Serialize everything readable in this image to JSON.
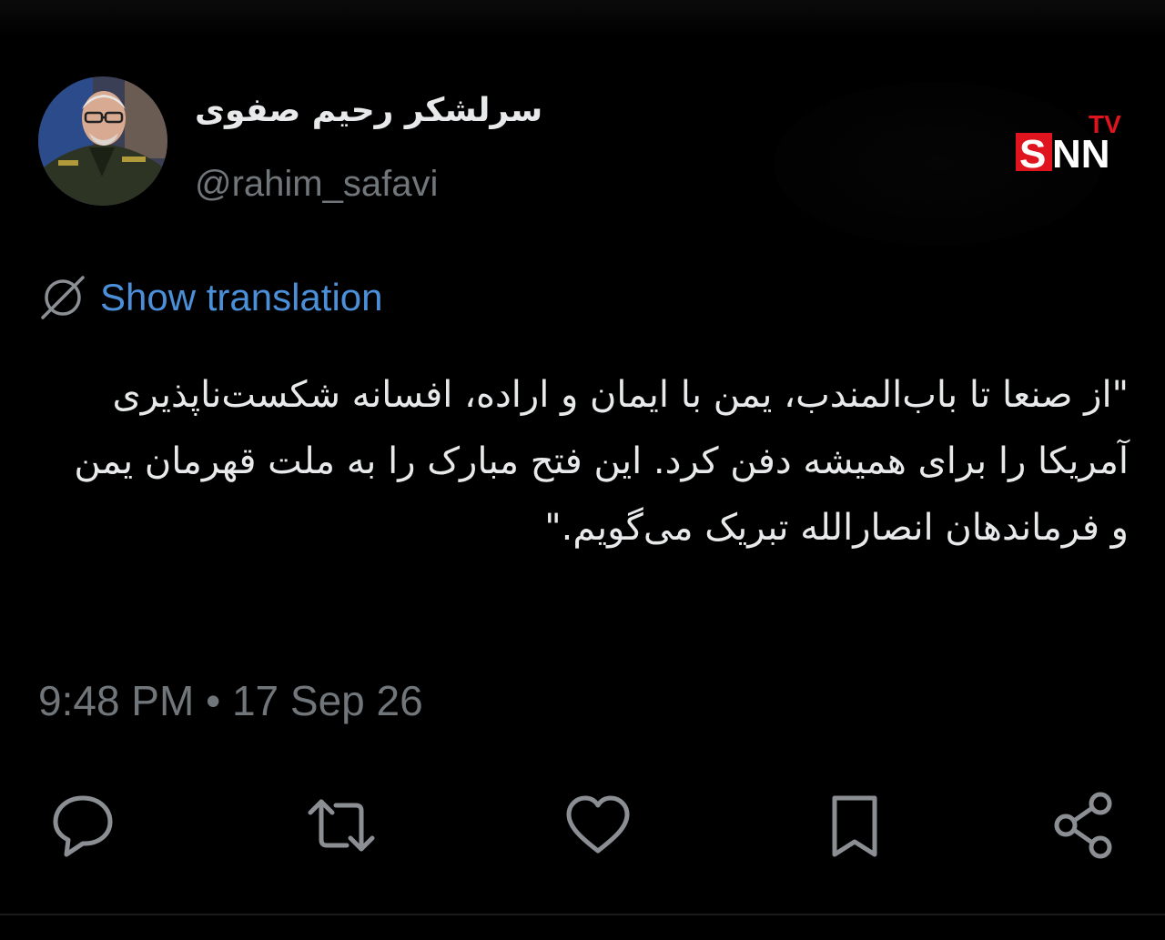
{
  "tweet": {
    "author": {
      "display_name": "سرلشکر رحیم صفوی",
      "handle": "@rahim_safavi"
    },
    "translate_label": "Show translation",
    "text": "\"از صنعا تا باب‌المندب، یمن با ایمان و اراده، افسانه شکست‌ناپذیری آمریکا را برای همیشه دفن کرد. این فتح مبارک را به ملت قهرمان یمن و فرماندهان انصارالله تبریک می‌گویم.\"",
    "timestamp": "9:48 PM • 17 Sep 26"
  },
  "watermark": {
    "tv": "TV",
    "s": "S",
    "nn": "NN"
  },
  "actions": [
    {
      "name": "reply-icon"
    },
    {
      "name": "retweet-icon"
    },
    {
      "name": "like-icon"
    },
    {
      "name": "bookmark-icon"
    },
    {
      "name": "share-icon"
    }
  ],
  "colors": {
    "background": "#000000",
    "text": "#e7e9ea",
    "secondary": "#71767b",
    "link": "#4a8fd8",
    "snn_red": "#e0141e"
  }
}
